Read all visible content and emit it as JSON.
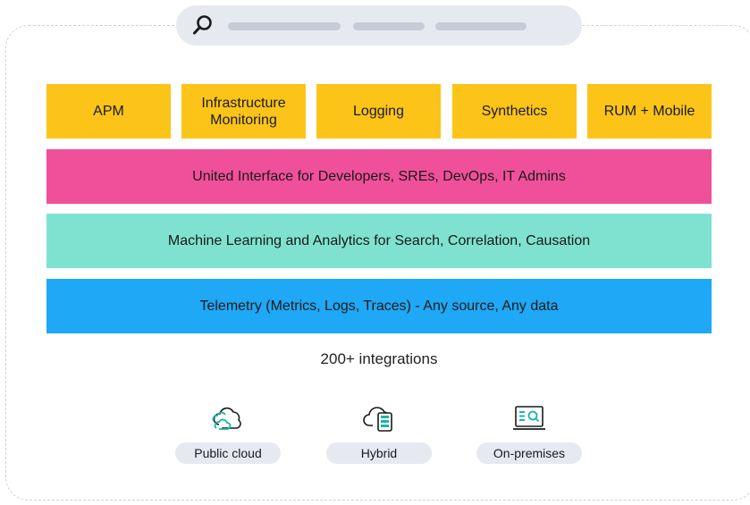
{
  "search": {
    "icon": "search-icon"
  },
  "modules": [
    "APM",
    "Infrastructure\nMonitoring",
    "Logging",
    "Synthetics",
    "RUM + Mobile"
  ],
  "layers": {
    "interface": "United Interface for Developers, SREs, DevOps, IT Admins",
    "ml": "Machine Learning and Analytics for Search, Correlation, Causation",
    "telemetry": "Telemetry (Metrics, Logs, Traces) - Any source, Any data"
  },
  "integrations": "200+ integrations",
  "deployments": [
    {
      "label": "Public cloud",
      "icon": "public-cloud-icon"
    },
    {
      "label": "Hybrid",
      "icon": "hybrid-cloud-icon"
    },
    {
      "label": "On-premises",
      "icon": "on-premises-icon"
    }
  ],
  "colors": {
    "modules": "#fcc419",
    "interface": "#f0509a",
    "ml": "#7fe2d1",
    "telemetry": "#1ea8f5",
    "pill": "#e7e9f1"
  }
}
